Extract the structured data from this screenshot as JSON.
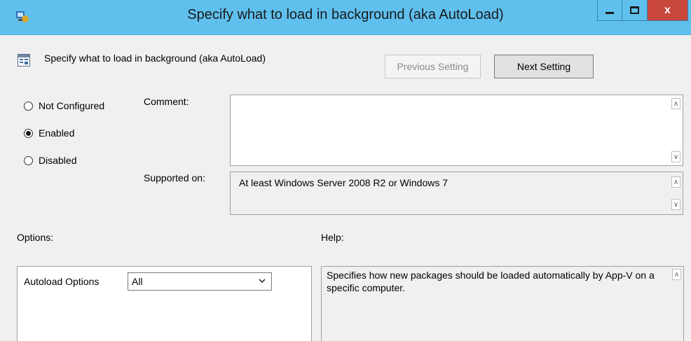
{
  "window": {
    "title": "Specify what to load in background (aka AutoLoad)",
    "close_label": "x"
  },
  "header": {
    "policy_title": "Specify what to load in background (aka AutoLoad)",
    "prev_label": "Previous Setting",
    "next_label": "Next Setting"
  },
  "state": {
    "options": [
      {
        "label": "Not Configured",
        "selected": false
      },
      {
        "label": "Enabled",
        "selected": true
      },
      {
        "label": "Disabled",
        "selected": false
      }
    ]
  },
  "comment": {
    "label": "Comment:",
    "value": ""
  },
  "supported": {
    "label": "Supported on:",
    "value": "At least Windows Server 2008 R2 or Windows 7"
  },
  "options_panel": {
    "label": "Options:",
    "autoload_label": "Autoload Options",
    "autoload_value": "All"
  },
  "help_panel": {
    "label": "Help:",
    "text": "Specifies how new packages should be loaded automatically by App-V on a specific computer."
  },
  "colors": {
    "titlebar": "#5fc0ee",
    "close_button": "#c9463d",
    "window_bg": "#f0f0f0"
  }
}
